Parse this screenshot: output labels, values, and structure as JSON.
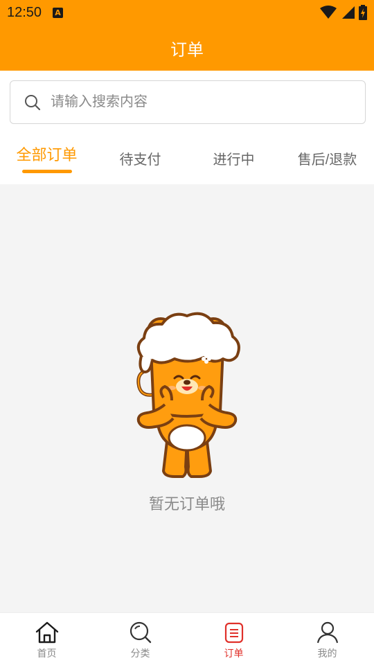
{
  "status_bar": {
    "time": "12:50",
    "notification_icon_letter": "A",
    "icons": [
      "wifi-icon",
      "signal-icon",
      "battery-charging-icon"
    ]
  },
  "header": {
    "title": "订单"
  },
  "search": {
    "placeholder": "请输入搜索内容",
    "value": ""
  },
  "tabs": [
    {
      "label": "全部订单",
      "active": true
    },
    {
      "label": "待支付",
      "active": false
    },
    {
      "label": "进行中",
      "active": false
    },
    {
      "label": "售后/退款",
      "active": false
    }
  ],
  "empty_state": {
    "message": "暂无订单哦"
  },
  "bottom_nav": [
    {
      "label": "首页",
      "icon": "home-icon",
      "active": false
    },
    {
      "label": "分类",
      "icon": "magnifier-icon",
      "active": false
    },
    {
      "label": "订单",
      "icon": "order-list-icon",
      "active": true
    },
    {
      "label": "我的",
      "icon": "user-icon",
      "active": false
    }
  ],
  "colors": {
    "brand": "#ff9900",
    "nav_active": "#e0302a",
    "muted_text": "#8a8a8a",
    "empty_background": "#f4f4f4"
  }
}
